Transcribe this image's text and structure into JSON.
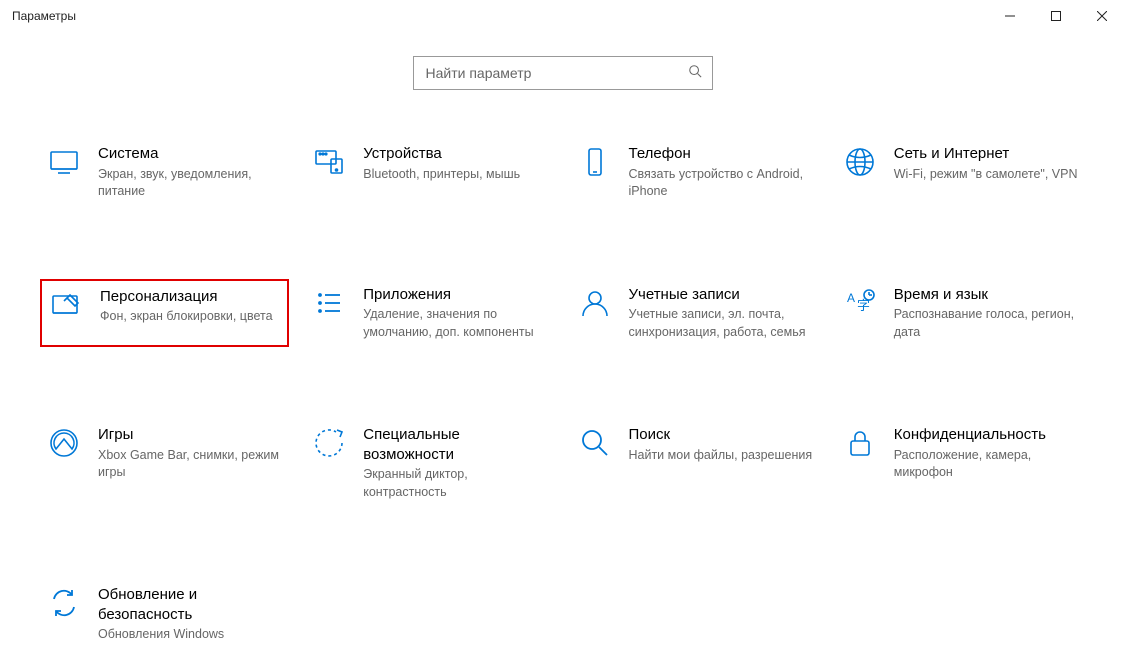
{
  "window": {
    "title": "Параметры"
  },
  "search": {
    "placeholder": "Найти параметр"
  },
  "tiles": {
    "system": {
      "title": "Система",
      "desc": "Экран, звук, уведомления, питание"
    },
    "devices": {
      "title": "Устройства",
      "desc": "Bluetooth, принтеры, мышь"
    },
    "phone": {
      "title": "Телефон",
      "desc": "Связать устройство с Android, iPhone"
    },
    "network": {
      "title": "Сеть и Интернет",
      "desc": "Wi-Fi, режим \"в самолете\", VPN"
    },
    "personalization": {
      "title": "Персонализация",
      "desc": "Фон, экран блокировки, цвета"
    },
    "apps": {
      "title": "Приложения",
      "desc": "Удаление, значения по умолчанию, доп. компоненты"
    },
    "accounts": {
      "title": "Учетные записи",
      "desc": "Учетные записи, эл. почта, синхронизация, работа, семья"
    },
    "timelang": {
      "title": "Время и язык",
      "desc": "Распознавание голоса, регион, дата"
    },
    "gaming": {
      "title": "Игры",
      "desc": "Xbox Game Bar, снимки, режим игры"
    },
    "ease": {
      "title": "Специальные возможности",
      "desc": "Экранный диктор, контрастность"
    },
    "search_tile": {
      "title": "Поиск",
      "desc": "Найти мои файлы, разрешения"
    },
    "privacy": {
      "title": "Конфиденциальность",
      "desc": "Расположение, камера, микрофон"
    },
    "update": {
      "title": "Обновление и безопасность",
      "desc": "Обновления Windows"
    }
  }
}
